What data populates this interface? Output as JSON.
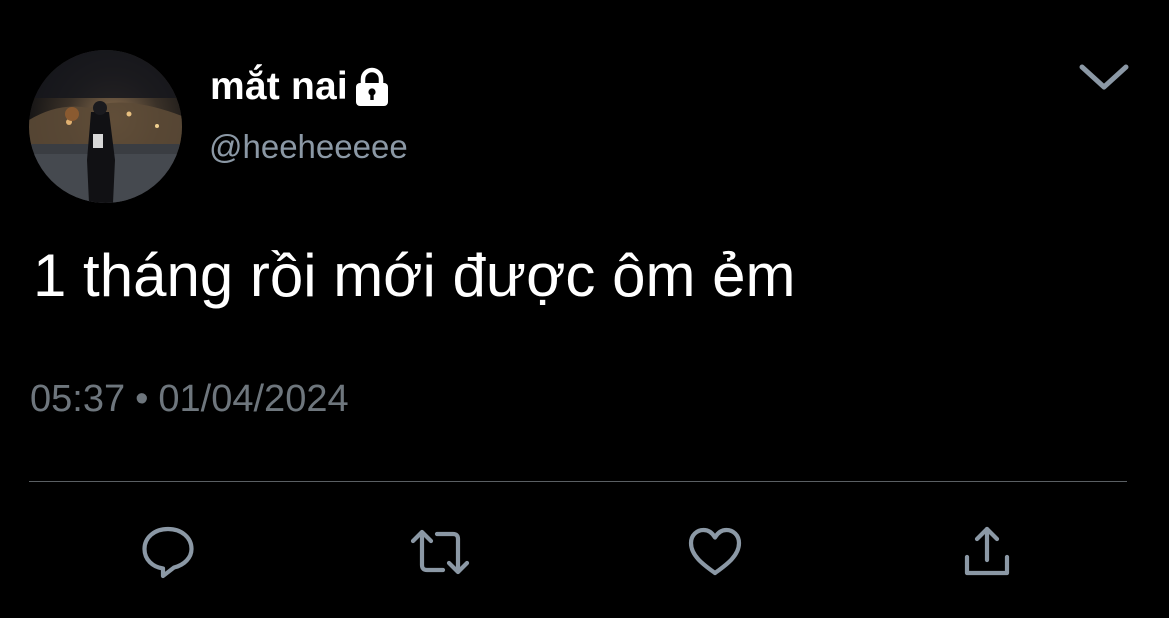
{
  "tweet": {
    "display_name": "mắt nai",
    "username": "@heeheeeee",
    "text": "1 tháng rồi mới được ôm ẻm",
    "time": "05:37",
    "separator": "•",
    "date": "01/04/2024",
    "protected": true
  },
  "icons": {
    "lock": "lock-icon",
    "menu": "chevron-down-icon",
    "reply": "reply-icon",
    "retweet": "retweet-icon",
    "like": "heart-icon",
    "share": "share-icon"
  },
  "colors": {
    "background": "#000000",
    "primary_text": "#ffffff",
    "secondary_text": "#8b98a5",
    "timestamp_text": "#6e767d",
    "icon": "#8b98a5",
    "divider": "#5a5f63"
  }
}
